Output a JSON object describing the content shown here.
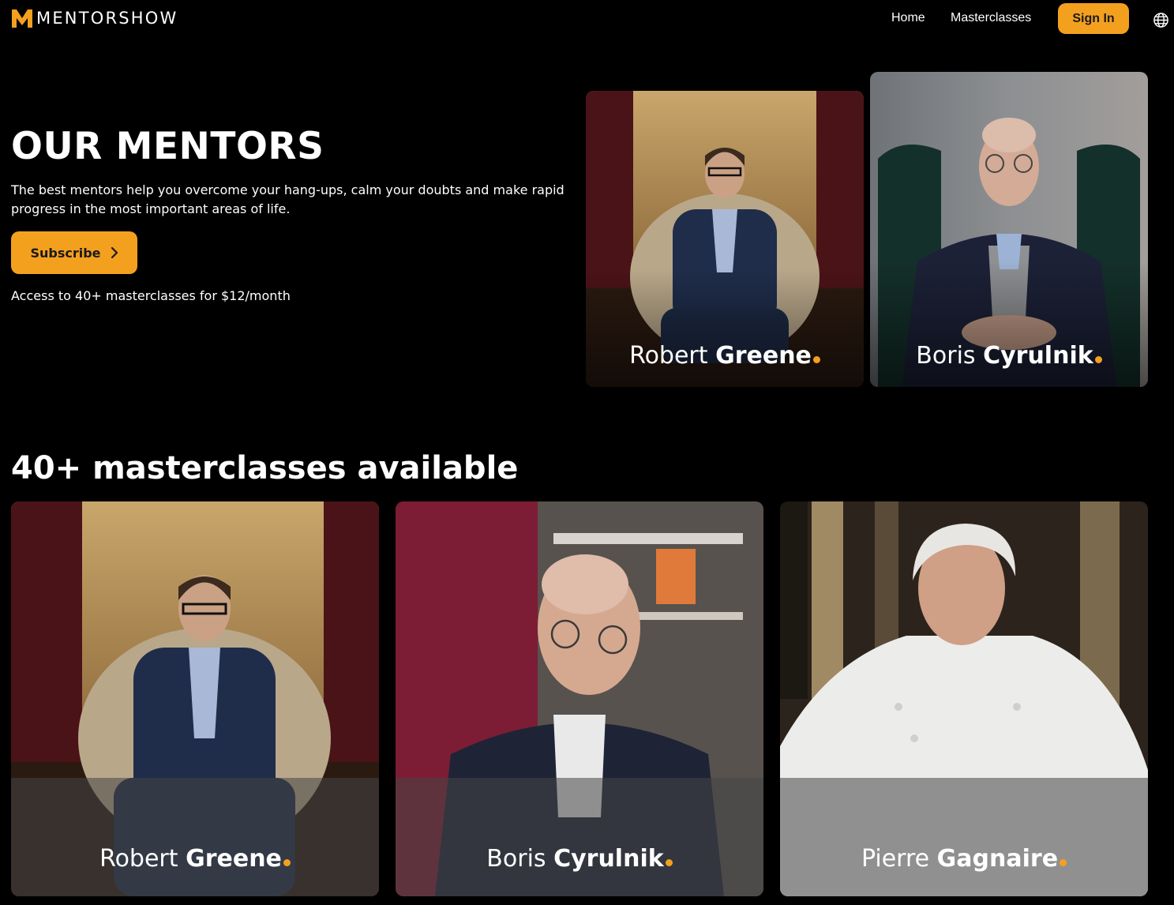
{
  "header": {
    "brand": "MENTORSHOW",
    "logo_icon": "m-logo-icon",
    "nav": {
      "home": "Home",
      "masterclasses": "Masterclasses"
    },
    "sign_in": "Sign In",
    "language_icon": "globe-icon"
  },
  "hero": {
    "title": "OUR MENTORS",
    "description": "The best mentors help you overcome your hang-ups, calm your doubts and make rapid progress in the most important areas of life.",
    "subscribe": "Subscribe",
    "subscribe_icon": "chevron-right-icon",
    "access": "Access to 40+ masterclasses for $12/month",
    "mentors": [
      {
        "first": "Robert",
        "last": "Greene"
      },
      {
        "first": "Boris",
        "last": "Cyrulnik"
      }
    ]
  },
  "masterclasses": {
    "title": "40+ masterclasses available",
    "cards": [
      {
        "first": "Robert",
        "last": "Greene"
      },
      {
        "first": "Boris",
        "last": "Cyrulnik"
      },
      {
        "first": "Pierre",
        "last": "Gagnaire"
      }
    ]
  },
  "colors": {
    "accent": "#f4a01f",
    "background": "#000000"
  }
}
